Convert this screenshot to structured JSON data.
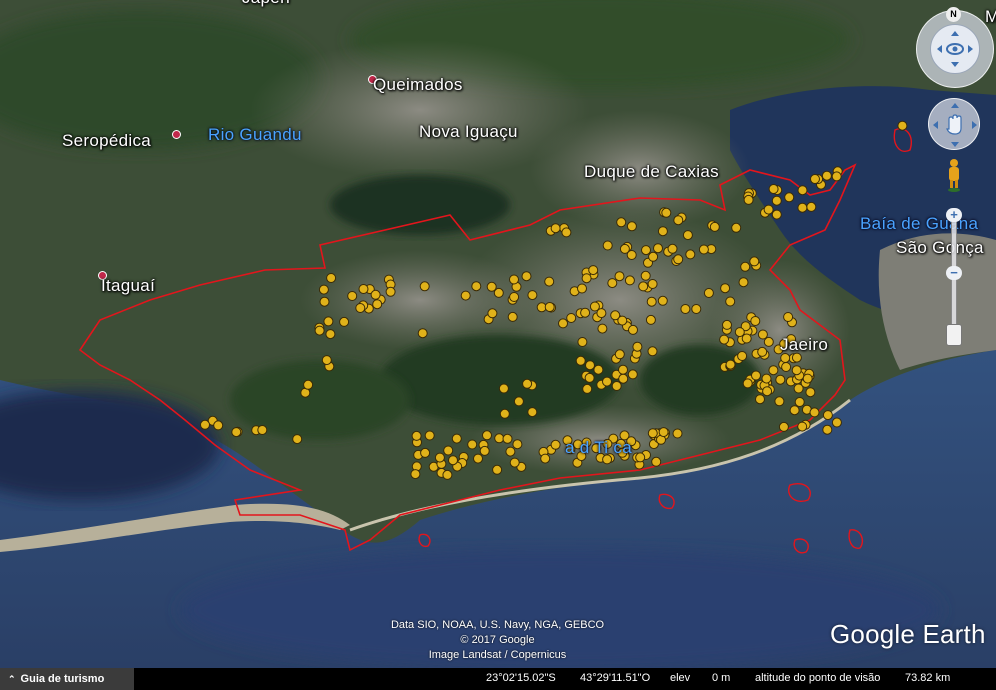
{
  "map": {
    "places": [
      {
        "id": "japeri",
        "name": "Japeri",
        "type": "city"
      },
      {
        "id": "queimados",
        "name": "Queimados",
        "type": "city"
      },
      {
        "id": "seropedica",
        "name": "Seropédica",
        "type": "city"
      },
      {
        "id": "rio-guandu",
        "name": "Rio Guandu",
        "type": "water"
      },
      {
        "id": "nova-iguacu",
        "name": "Nova Iguaçu",
        "type": "city"
      },
      {
        "id": "duque-de-caxias",
        "name": "Duque de Caxias",
        "type": "city"
      },
      {
        "id": "itaguai",
        "name": "Itaguaí",
        "type": "city"
      },
      {
        "id": "baia-de-guanabara",
        "name": "Baía de Guana",
        "type": "water"
      },
      {
        "id": "sao-goncalo",
        "name": "São Gonça",
        "type": "city"
      },
      {
        "id": "rio-de-janeiro",
        "name": "Jaeiro",
        "type": "city"
      },
      {
        "id": "barra-da-tijuca",
        "name": "a d  Ti  ca",
        "type": "water"
      },
      {
        "id": "edge-label",
        "name": "M",
        "type": "city"
      }
    ],
    "colors": {
      "boundary": "#e3151c",
      "marker": "#e0b21a",
      "sea": "#2f4a78",
      "land": "#3a4b35"
    }
  },
  "attribution": {
    "line1": "Data SIO, NOAA, U.S. Navy, NGA, GEBCO",
    "line2": "© 2017 Google",
    "line3": "Image Landsat / Copernicus"
  },
  "logo": "Google Earth",
  "nav": {
    "north_label": "N",
    "zoom_in": "+",
    "zoom_out": "−",
    "look_icon": "eye-icon",
    "move_icon": "hand-icon",
    "pegman_icon": "pegman-icon"
  },
  "status": {
    "tour_label": "Guia de turismo",
    "lat": "23°02'15.02\"S",
    "lon": "43°29'11.51\"O",
    "elev_label": "elev",
    "elev_value": "0 m",
    "eye_alt_label": "altitude do ponto de visão",
    "eye_alt_value": "73.82 km"
  }
}
